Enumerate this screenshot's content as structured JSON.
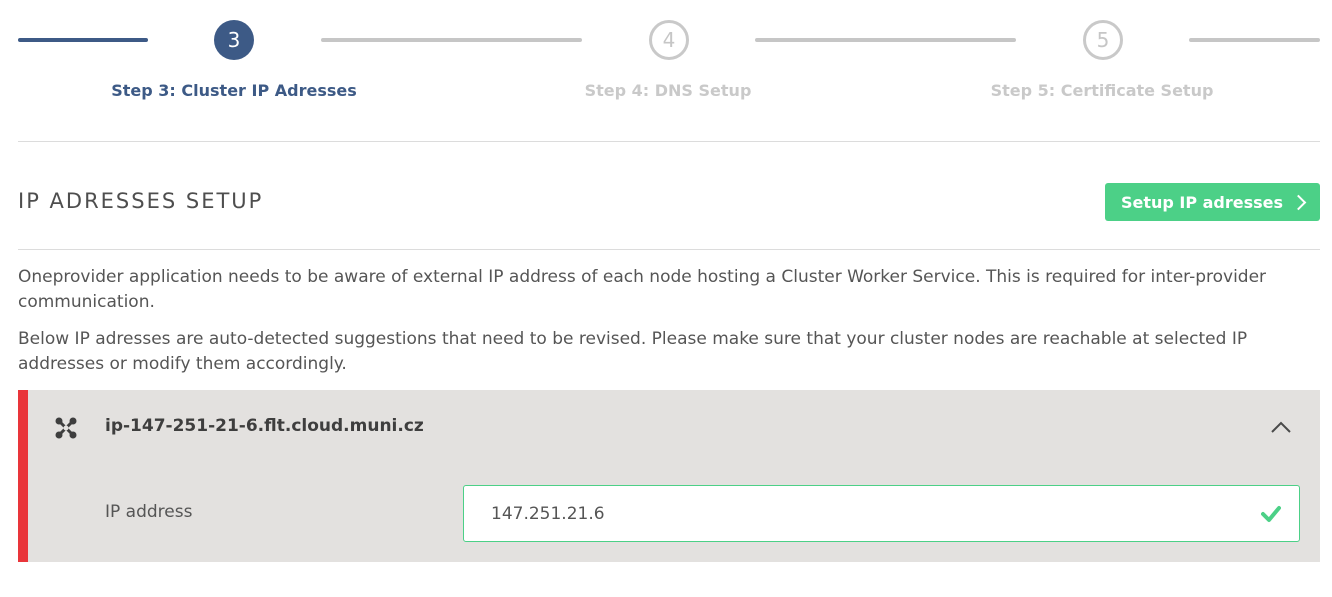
{
  "steps": [
    {
      "number": "3",
      "label": "Step 3: Cluster IP Adresses",
      "state": "active"
    },
    {
      "number": "4",
      "label": "Step 4: DNS Setup",
      "state": "pending"
    },
    {
      "number": "5",
      "label": "Step 5: Certificate Setup",
      "state": "pending"
    }
  ],
  "section": {
    "title": "IP ADRESSES SETUP",
    "setup_button_label": "Setup IP adresses"
  },
  "description": {
    "paragraph1": "Oneprovider application needs to be aware of external IP address of each node hosting a Cluster Worker Service. This is required for inter-provider communication.",
    "paragraph2": "Below IP adresses are auto-detected suggestions that need to be revised. Please make sure that your cluster nodes are reachable at selected IP addresses or modify them accordingly."
  },
  "node": {
    "hostname": "ip-147-251-21-6.flt.cloud.muni.cz",
    "field_label": "IP address",
    "ip_value": "147.251.21.6",
    "icon": "node-icon",
    "expanded": true
  },
  "colors": {
    "primary": "#3d5a86",
    "success": "#4cd087",
    "error_bar": "#e9353a",
    "panel_bg": "#e3e1df",
    "pending": "#c6c6c6"
  }
}
